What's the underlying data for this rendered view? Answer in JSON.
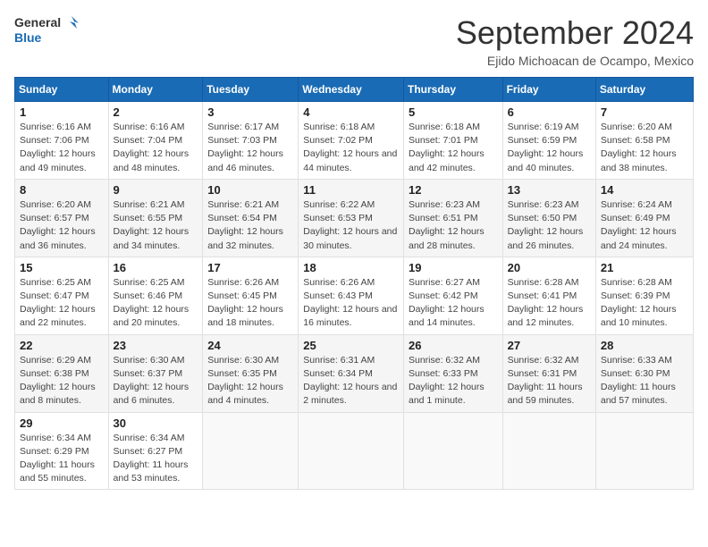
{
  "logo": {
    "line1": "General",
    "line2": "Blue"
  },
  "title": "September 2024",
  "location": "Ejido Michoacan de Ocampo, Mexico",
  "days_of_week": [
    "Sunday",
    "Monday",
    "Tuesday",
    "Wednesday",
    "Thursday",
    "Friday",
    "Saturday"
  ],
  "weeks": [
    [
      {
        "day": "1",
        "sunrise": "6:16 AM",
        "sunset": "7:06 PM",
        "daylight": "12 hours and 49 minutes."
      },
      {
        "day": "2",
        "sunrise": "6:16 AM",
        "sunset": "7:04 PM",
        "daylight": "12 hours and 48 minutes."
      },
      {
        "day": "3",
        "sunrise": "6:17 AM",
        "sunset": "7:03 PM",
        "daylight": "12 hours and 46 minutes."
      },
      {
        "day": "4",
        "sunrise": "6:18 AM",
        "sunset": "7:02 PM",
        "daylight": "12 hours and 44 minutes."
      },
      {
        "day": "5",
        "sunrise": "6:18 AM",
        "sunset": "7:01 PM",
        "daylight": "12 hours and 42 minutes."
      },
      {
        "day": "6",
        "sunrise": "6:19 AM",
        "sunset": "6:59 PM",
        "daylight": "12 hours and 40 minutes."
      },
      {
        "day": "7",
        "sunrise": "6:20 AM",
        "sunset": "6:58 PM",
        "daylight": "12 hours and 38 minutes."
      }
    ],
    [
      {
        "day": "8",
        "sunrise": "6:20 AM",
        "sunset": "6:57 PM",
        "daylight": "12 hours and 36 minutes."
      },
      {
        "day": "9",
        "sunrise": "6:21 AM",
        "sunset": "6:55 PM",
        "daylight": "12 hours and 34 minutes."
      },
      {
        "day": "10",
        "sunrise": "6:21 AM",
        "sunset": "6:54 PM",
        "daylight": "12 hours and 32 minutes."
      },
      {
        "day": "11",
        "sunrise": "6:22 AM",
        "sunset": "6:53 PM",
        "daylight": "12 hours and 30 minutes."
      },
      {
        "day": "12",
        "sunrise": "6:23 AM",
        "sunset": "6:51 PM",
        "daylight": "12 hours and 28 minutes."
      },
      {
        "day": "13",
        "sunrise": "6:23 AM",
        "sunset": "6:50 PM",
        "daylight": "12 hours and 26 minutes."
      },
      {
        "day": "14",
        "sunrise": "6:24 AM",
        "sunset": "6:49 PM",
        "daylight": "12 hours and 24 minutes."
      }
    ],
    [
      {
        "day": "15",
        "sunrise": "6:25 AM",
        "sunset": "6:47 PM",
        "daylight": "12 hours and 22 minutes."
      },
      {
        "day": "16",
        "sunrise": "6:25 AM",
        "sunset": "6:46 PM",
        "daylight": "12 hours and 20 minutes."
      },
      {
        "day": "17",
        "sunrise": "6:26 AM",
        "sunset": "6:45 PM",
        "daylight": "12 hours and 18 minutes."
      },
      {
        "day": "18",
        "sunrise": "6:26 AM",
        "sunset": "6:43 PM",
        "daylight": "12 hours and 16 minutes."
      },
      {
        "day": "19",
        "sunrise": "6:27 AM",
        "sunset": "6:42 PM",
        "daylight": "12 hours and 14 minutes."
      },
      {
        "day": "20",
        "sunrise": "6:28 AM",
        "sunset": "6:41 PM",
        "daylight": "12 hours and 12 minutes."
      },
      {
        "day": "21",
        "sunrise": "6:28 AM",
        "sunset": "6:39 PM",
        "daylight": "12 hours and 10 minutes."
      }
    ],
    [
      {
        "day": "22",
        "sunrise": "6:29 AM",
        "sunset": "6:38 PM",
        "daylight": "12 hours and 8 minutes."
      },
      {
        "day": "23",
        "sunrise": "6:30 AM",
        "sunset": "6:37 PM",
        "daylight": "12 hours and 6 minutes."
      },
      {
        "day": "24",
        "sunrise": "6:30 AM",
        "sunset": "6:35 PM",
        "daylight": "12 hours and 4 minutes."
      },
      {
        "day": "25",
        "sunrise": "6:31 AM",
        "sunset": "6:34 PM",
        "daylight": "12 hours and 2 minutes."
      },
      {
        "day": "26",
        "sunrise": "6:32 AM",
        "sunset": "6:33 PM",
        "daylight": "12 hours and 1 minute."
      },
      {
        "day": "27",
        "sunrise": "6:32 AM",
        "sunset": "6:31 PM",
        "daylight": "11 hours and 59 minutes."
      },
      {
        "day": "28",
        "sunrise": "6:33 AM",
        "sunset": "6:30 PM",
        "daylight": "11 hours and 57 minutes."
      }
    ],
    [
      {
        "day": "29",
        "sunrise": "6:34 AM",
        "sunset": "6:29 PM",
        "daylight": "11 hours and 55 minutes."
      },
      {
        "day": "30",
        "sunrise": "6:34 AM",
        "sunset": "6:27 PM",
        "daylight": "11 hours and 53 minutes."
      },
      null,
      null,
      null,
      null,
      null
    ]
  ]
}
